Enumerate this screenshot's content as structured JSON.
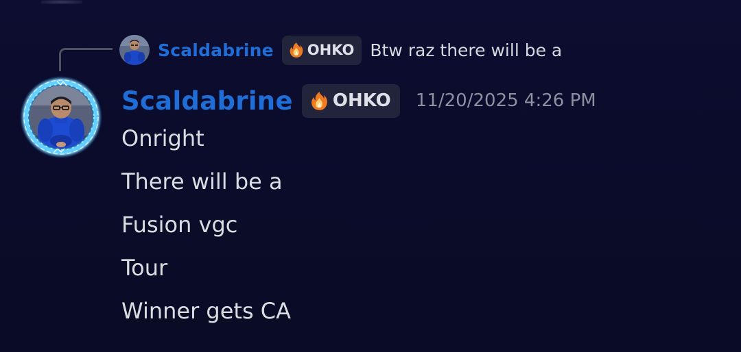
{
  "reply": {
    "author": "Scaldabrine",
    "tag": "OHKO",
    "text": "Btw raz there will be a"
  },
  "message": {
    "author": "Scaldabrine",
    "tag": "OHKO",
    "timestamp": "11/20/2025 4:26 PM",
    "lines": [
      "Onright",
      "There will be a",
      "Fusion vgc",
      "Tour",
      "Winner gets CA"
    ]
  },
  "colors": {
    "username": "#1f6dd6",
    "tag_background": "#22243c",
    "timestamp": "#8e90a0",
    "message_text": "#dcdde3",
    "background": "#0b0c2b"
  },
  "icons": {
    "tag_icon": "flame-icon",
    "avatar_decoration": "lightning-ring"
  }
}
